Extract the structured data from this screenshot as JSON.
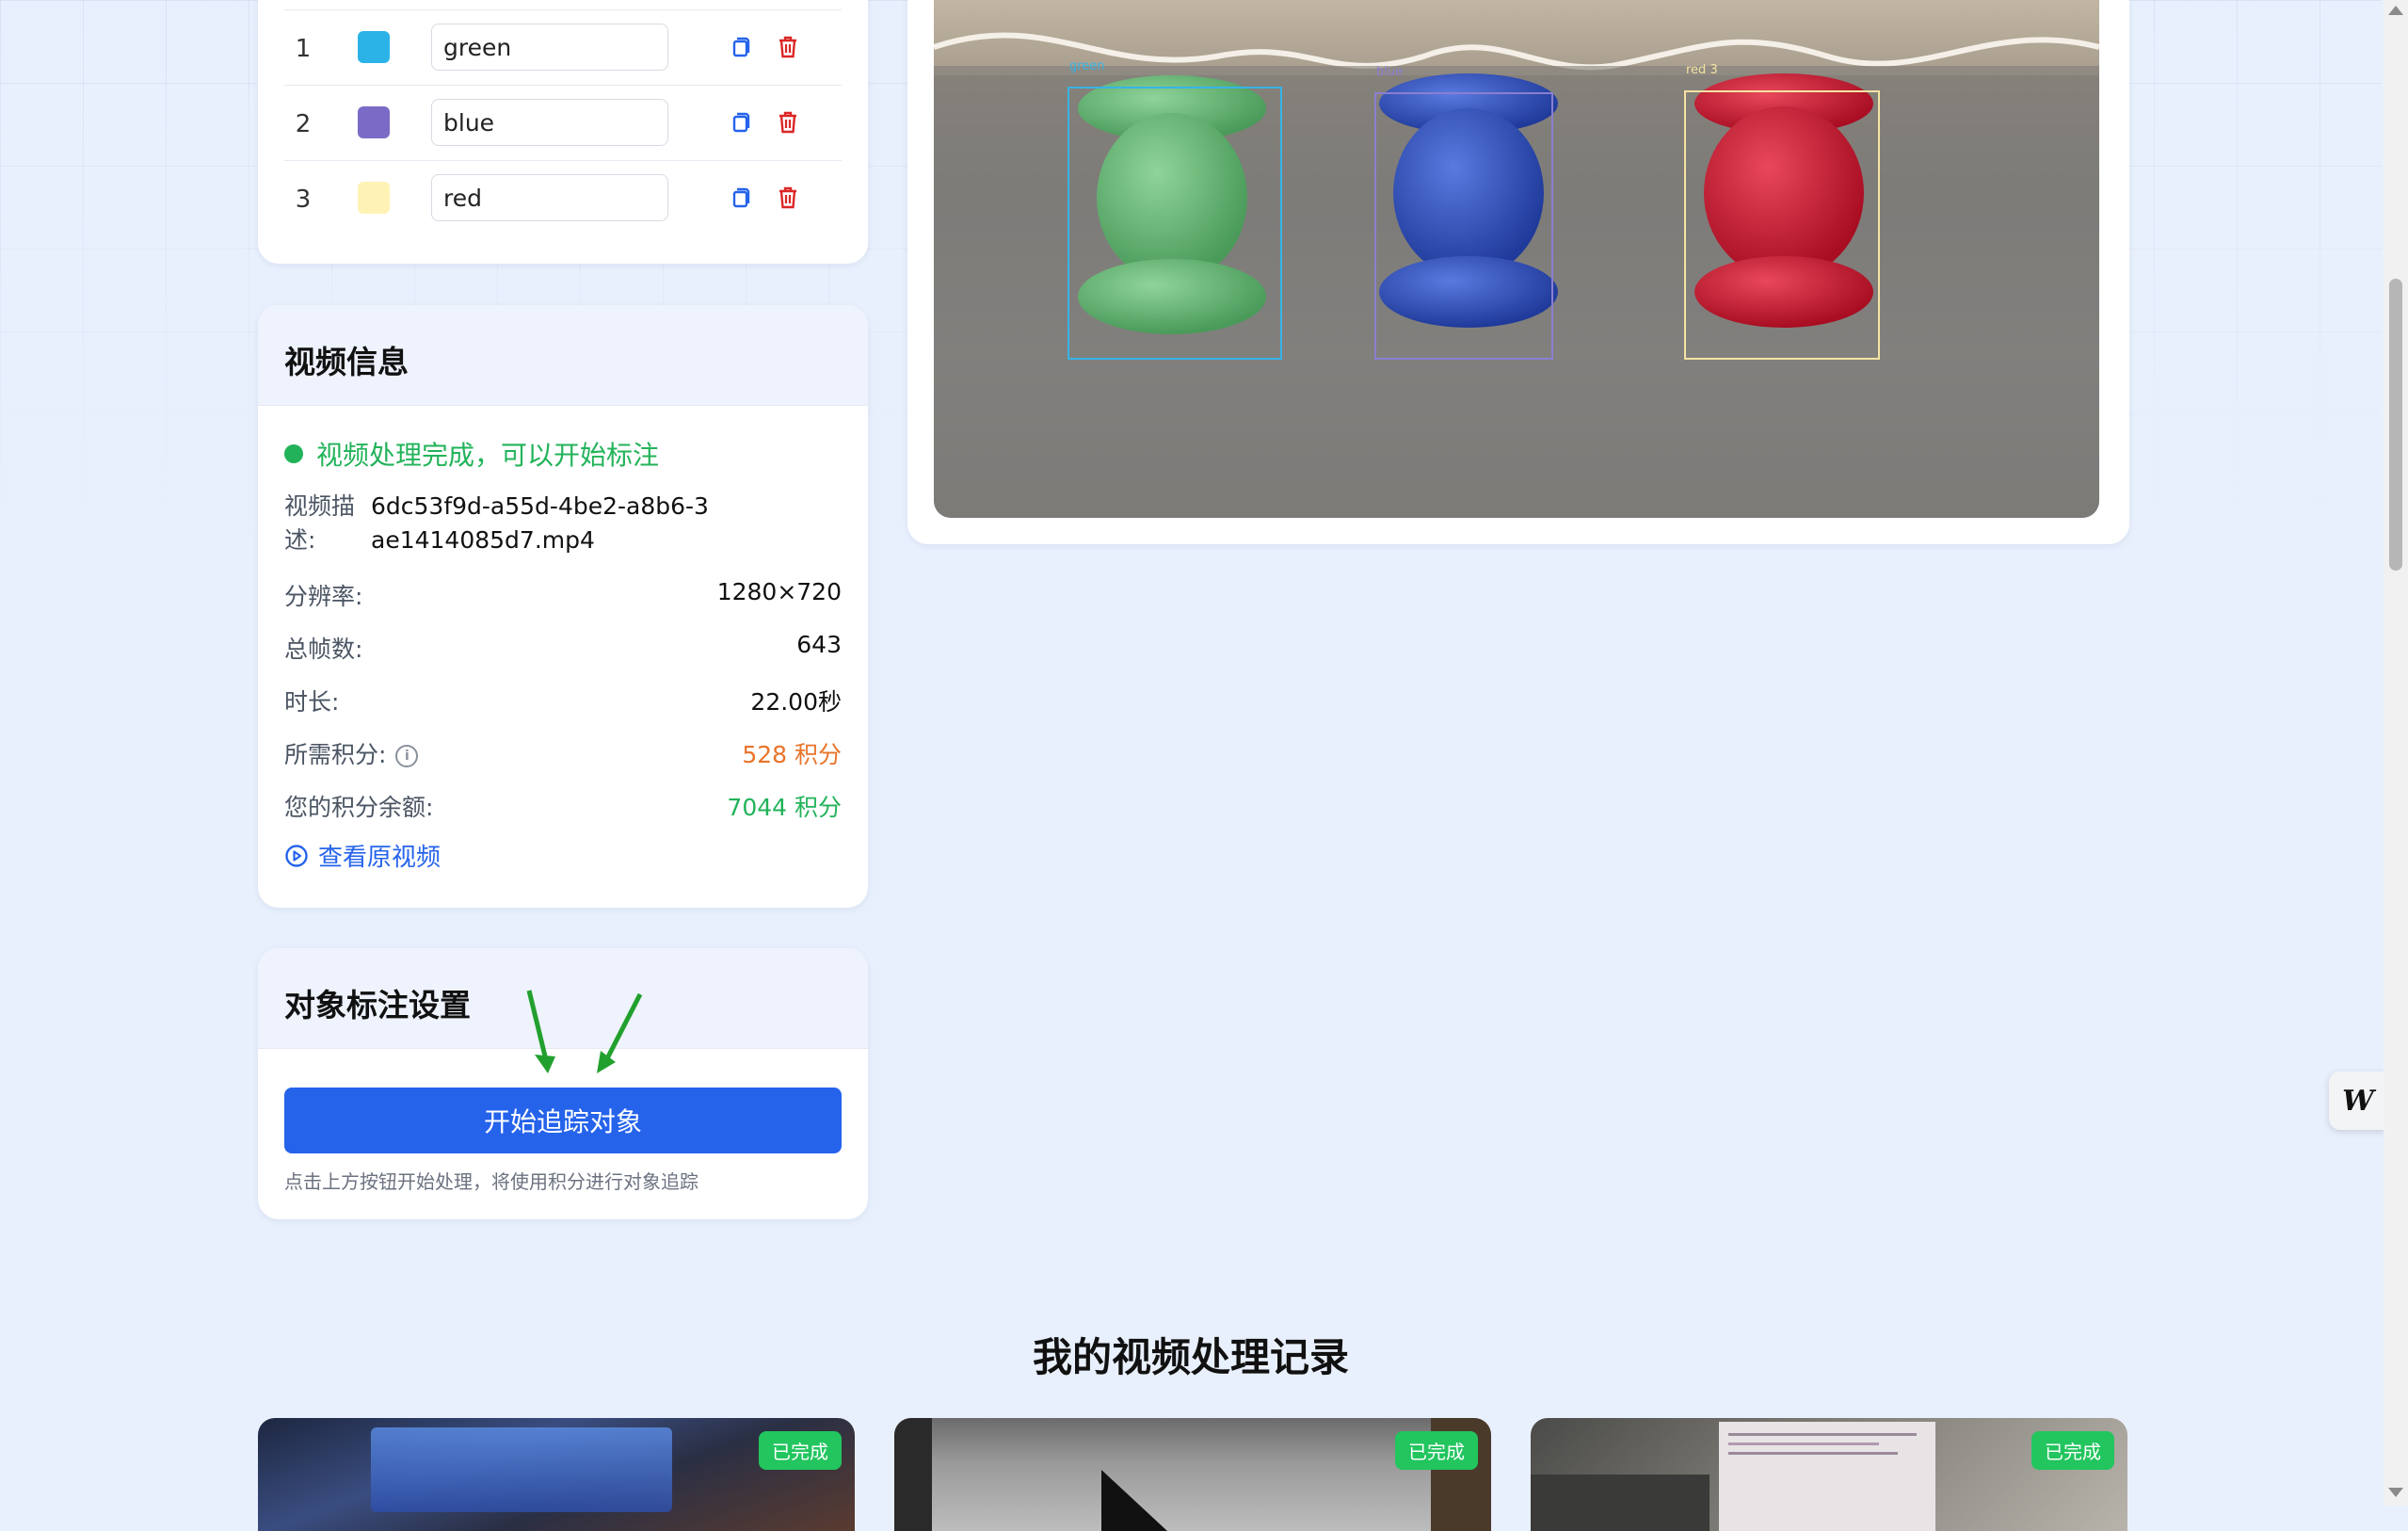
{
  "labels": {
    "items": [
      {
        "index": "1",
        "name": "green",
        "color": "#2bb3e8"
      },
      {
        "index": "2",
        "name": "blue",
        "color": "#7b6bc6"
      },
      {
        "index": "3",
        "name": "red",
        "color": "#fff2b5"
      }
    ]
  },
  "video_preview": {
    "boxes": [
      {
        "label": "green",
        "color": "#36b4e6"
      },
      {
        "label": "blue",
        "color": "#8a7fd1"
      },
      {
        "label": "red 3",
        "color": "#f4e3a2"
      }
    ]
  },
  "video_info": {
    "title": "视频信息",
    "status": "视频处理完成，可以开始标注",
    "desc_label": "视频描述:",
    "desc_value": "6dc53f9d-a55d-4be2-a8b6-3ae1414085d7.mp4",
    "resolution_label": "分辨率:",
    "resolution_value": "1280×720",
    "frames_label": "总帧数:",
    "frames_value": "643",
    "duration_label": "时长:",
    "duration_value": "22.00秒",
    "cost_label": "所需积分:",
    "cost_value": "528 积分",
    "balance_label": "您的积分余额:",
    "balance_value": "7044 积分",
    "view_link": "查看原视频",
    "colors": {
      "cost": "#e8742a",
      "balance": "#22b35a",
      "status": "#22b35a"
    }
  },
  "tracking_settings": {
    "title": "对象标注设置",
    "start_button": "开始追踪对象",
    "hint": "点击上方按钮开始处理，将使用积分进行对象追踪"
  },
  "history": {
    "title": "我的视频处理记录",
    "cards": [
      {
        "badge": "已完成"
      },
      {
        "badge": "已完成"
      },
      {
        "badge": "已完成"
      }
    ]
  },
  "accent_color": "#2563eb"
}
